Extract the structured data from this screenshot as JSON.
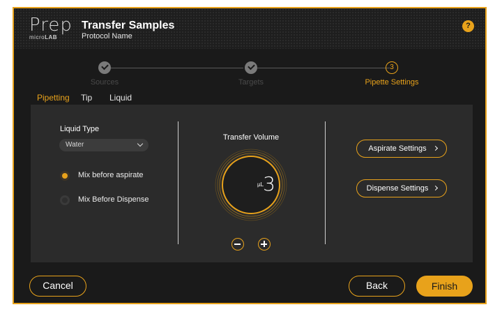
{
  "header": {
    "logo_main": "Prep",
    "logo_sub_prefix": "micro",
    "logo_sub_bold": "LAB",
    "title": "Transfer Samples",
    "subtitle": "Protocol Name",
    "help_label": "?"
  },
  "stepper": {
    "steps": [
      {
        "label": "Sources",
        "state": "done"
      },
      {
        "label": "Targets",
        "state": "done"
      },
      {
        "label": "Pipette Settings",
        "state": "current",
        "number": "3"
      }
    ]
  },
  "tabs": [
    {
      "label": "Pipetting",
      "active": true
    },
    {
      "label": "Tip",
      "active": false
    },
    {
      "label": "Liquid",
      "active": false
    }
  ],
  "liquid": {
    "type_label": "Liquid Type",
    "type_value": "Water",
    "options": [
      {
        "label": "Mix before aspirate",
        "selected": true
      },
      {
        "label": "Mix Before Dispense",
        "selected": false
      }
    ]
  },
  "volume": {
    "title": "Transfer Volume",
    "value": "3",
    "unit": "µL"
  },
  "settings": {
    "aspirate_label": "Aspirate Settings",
    "dispense_label": "Dispense Settings"
  },
  "footer": {
    "cancel_label": "Cancel",
    "back_label": "Back",
    "finish_label": "Finish"
  },
  "colors": {
    "accent": "#e8a21b",
    "background": "#1a1a1a",
    "panel": "#2b2b2b"
  }
}
